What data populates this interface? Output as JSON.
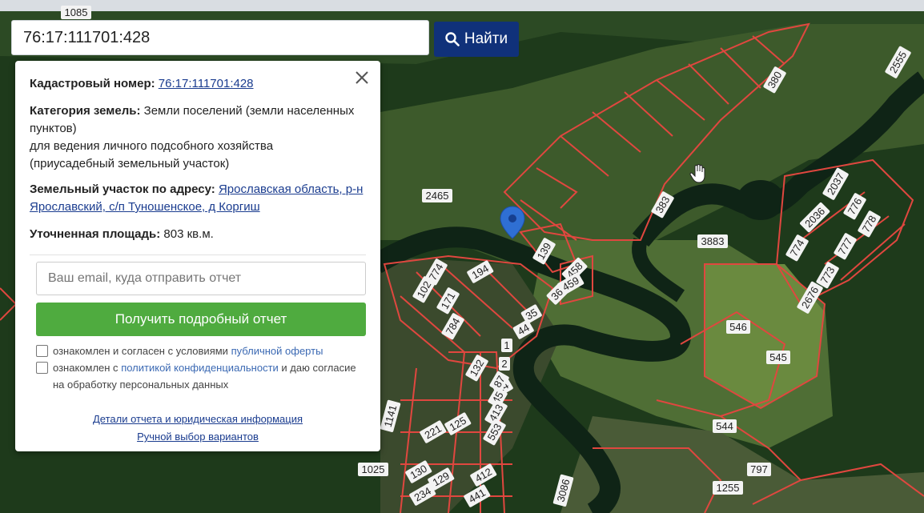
{
  "search": {
    "value": "76:17:111701:428",
    "button_label": "Найти"
  },
  "popup": {
    "cadastral_label": "Кадастровый номер:",
    "cadastral_value": "76:17:111701:428",
    "category_label": "Категория земель:",
    "category_value": "Земли поселений (земли населенных пунктов)",
    "usage_line1": "для ведения личного подсобного хозяйства",
    "usage_line2": "(приусадебный земельный участок)",
    "address_label": "Земельный участок по адресу:",
    "address_value": "Ярославская область, р-н Ярославский, с/п Туношенское, д Коргиш",
    "area_label": "Уточненная площадь:",
    "area_value": "803 кв.м.",
    "email_placeholder": "Ваш email, куда отправить отчет",
    "get_report_button": "Получить подробный отчет",
    "consent1_text": "ознакомлен и согласен с условиями",
    "consent1_link": "публичной оферты",
    "consent2_text": "ознакомлен с",
    "consent2_link": "политикой конфиденциальности",
    "consent2_rest": "и даю согласие на обработку персональных данных",
    "details_link": "Детали отчета и юридическая информация",
    "manual_link": "Ручной выбор вариантов"
  },
  "map": {
    "parcel_numbers": [
      "1085",
      "2465",
      "380",
      "2555",
      "383",
      "3883",
      "2037",
      "776",
      "778",
      "2036",
      "777",
      "774",
      "773",
      "2676",
      "139",
      "458",
      "459",
      "36",
      "35",
      "44",
      "194",
      "774",
      "102",
      "171",
      "784",
      "1",
      "2",
      "24",
      "87",
      "45",
      "413",
      "553",
      "132",
      "125",
      "221",
      "1141",
      "1025",
      "130",
      "129",
      "234",
      "412",
      "441",
      "546",
      "545",
      "544",
      "797",
      "1255",
      "3086"
    ]
  },
  "colors": {
    "search_button": "#10317a",
    "report_button": "#4fab3f",
    "parcel_border": "#e0473f",
    "marker": "#2f6fd3"
  }
}
